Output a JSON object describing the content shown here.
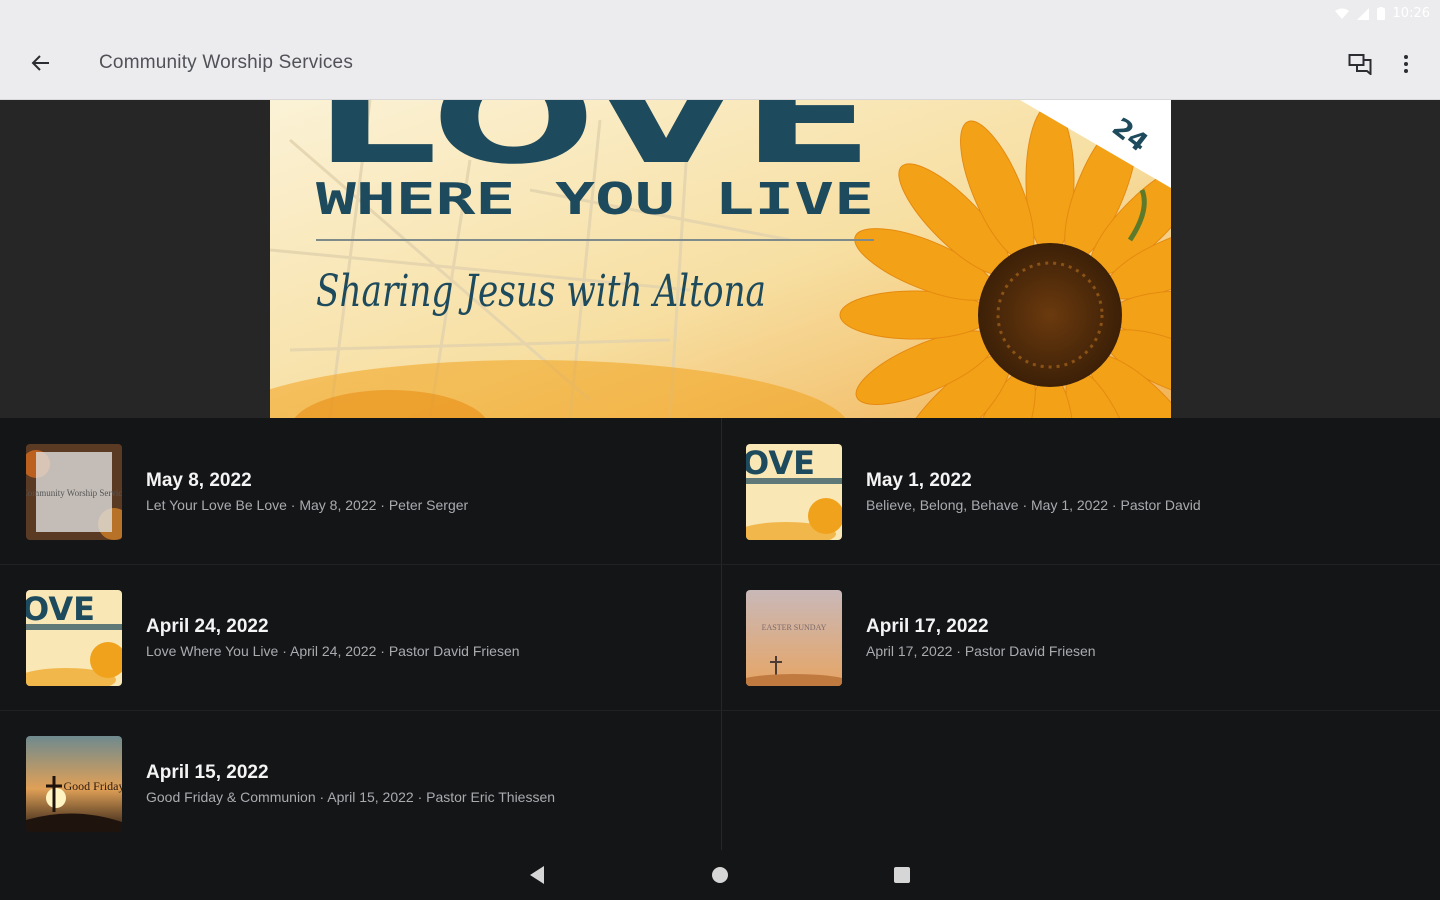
{
  "status_bar": {
    "time": "10:26"
  },
  "app_bar": {
    "title": "Community Worship Services"
  },
  "hero": {
    "headline": "LOVE",
    "subheadline": "WHERE YOU LIVE",
    "script_line": "Sharing Jesus with Altona",
    "corner_text": "24"
  },
  "sermons": [
    {
      "title": "May 8, 2022",
      "subtitle": "Let Your Love Be Love · May 8, 2022 · Peter Serger",
      "thumb_text": "Community Worship Service"
    },
    {
      "title": "May 1, 2022",
      "subtitle": "Believe, Belong, Behave · May 1, 2022 · Pastor David",
      "thumb_text": "OVE"
    },
    {
      "title": "April 24, 2022",
      "subtitle": "Love Where You Live · April 24, 2022 · Pastor David Friesen",
      "thumb_text": "OVE"
    },
    {
      "title": "April 17, 2022",
      "subtitle": "April 17, 2022 · Pastor David Friesen",
      "thumb_text": "EASTER SUNDAY"
    },
    {
      "title": "April 15, 2022",
      "subtitle": "Good Friday & Communion · April 15, 2022 · Pastor Eric Thiessen",
      "thumb_text": "Good Friday"
    }
  ],
  "colors": {
    "background": "#141517",
    "appbar": "#ececee",
    "hero_teal": "#1d4a5c",
    "sunflower": "#f0a21c"
  }
}
